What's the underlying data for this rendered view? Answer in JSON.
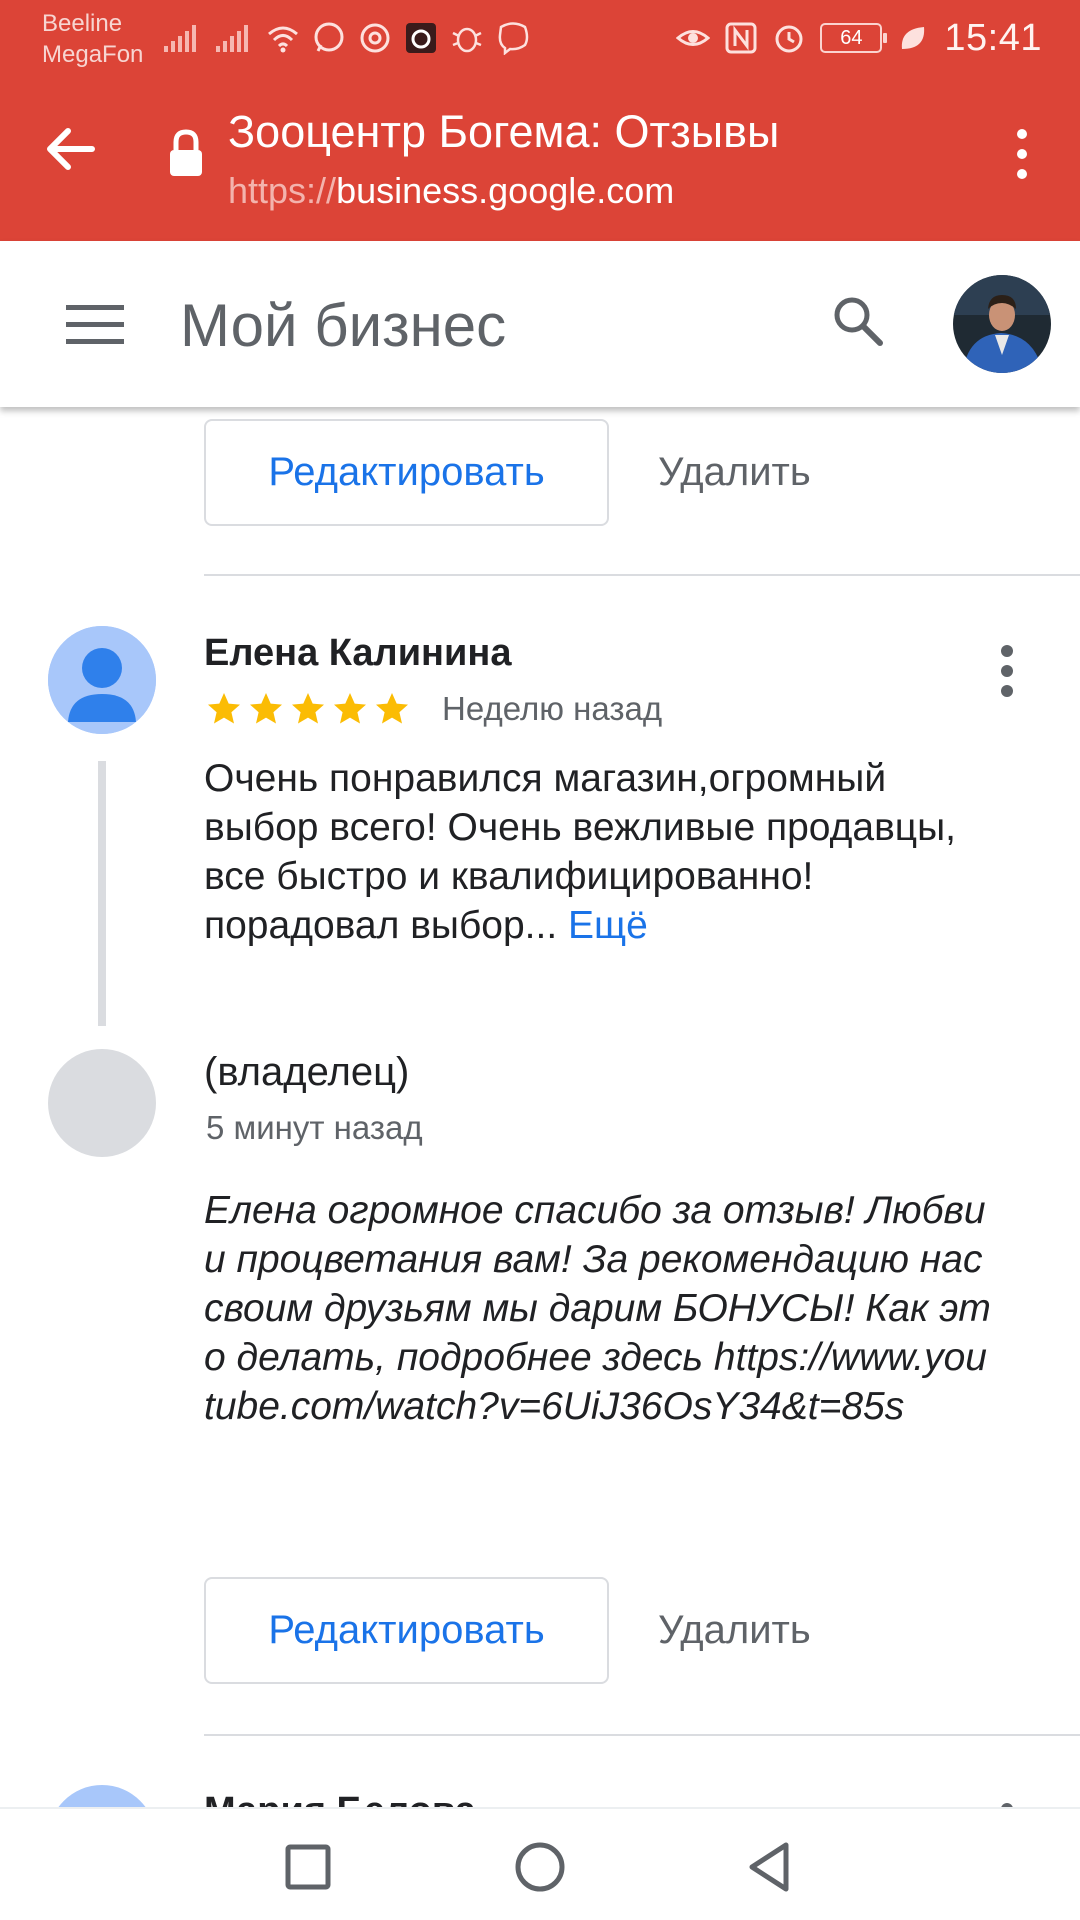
{
  "status_bar": {
    "carrier_1": "Beeline",
    "carrier_2": "MegaFon",
    "battery": "64",
    "time": "15:41",
    "icons": [
      "signal-icon",
      "signal-icon",
      "wifi-icon",
      "whatsapp-icon",
      "at-icon",
      "app-icon",
      "bug-icon",
      "viber-icon",
      "eye-icon",
      "nfc-icon",
      "alarm-icon",
      "battery-icon",
      "leaf-icon"
    ]
  },
  "browser": {
    "title": "Зооцентр Богема: Отзывы",
    "url_scheme": "https://",
    "url_host": "business.google.com"
  },
  "app_bar": {
    "title": "Мой бизнес"
  },
  "actions": {
    "edit_label": "Редактировать",
    "delete_label": "Удалить"
  },
  "review": {
    "author": "Елена Калинина",
    "rating": 5,
    "time": "Неделю назад",
    "text": "Очень понравился магазин,огромный выбор всего! Очень вежливые продавцы, все быстро и квалифицированно!порадовал выбор...",
    "more_label": "Ещё"
  },
  "owner_reply": {
    "name": "(владелец)",
    "time": "5 минут назад",
    "text": "Елена огромное спасибо за отзыв! Любви и процветания вам! За рекомендацию нас своим друзьям мы дарим БОНУСЫ! Как это делать, подробнее здесь https://www.youtube.com/watch?v=6UiJ36OsY34&t=85s"
  },
  "next_review": {
    "author": "Мария Белова"
  },
  "colors": {
    "header_red": "#dc4437",
    "link_blue": "#1a73e8",
    "star_yellow": "#fbbc04",
    "avatar_blue": "#a8c7fa"
  }
}
